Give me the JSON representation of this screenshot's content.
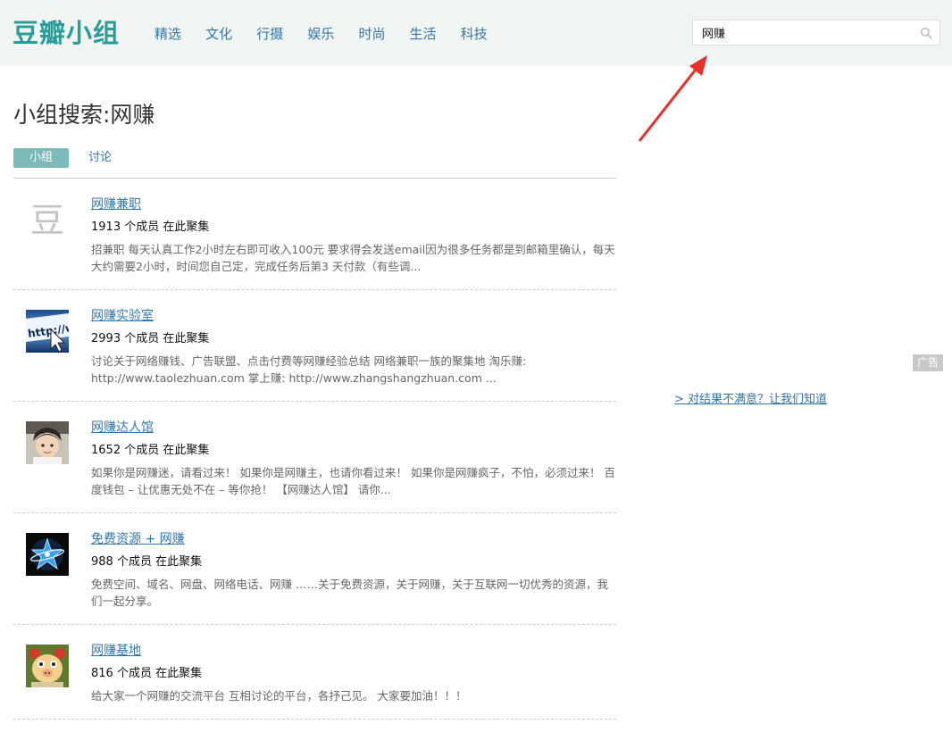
{
  "header": {
    "logo": "豆瓣小组",
    "nav": [
      "精选",
      "文化",
      "行摄",
      "娱乐",
      "时尚",
      "生活",
      "科技"
    ],
    "search_value": "网赚",
    "search_icon": "search-icon"
  },
  "page": {
    "title": "小组搜索:网赚",
    "tabs": {
      "active": "小组",
      "other": "讨论"
    }
  },
  "results": [
    {
      "name": "网赚兼职",
      "members": "1913 个成员 在此聚集",
      "desc": "招兼职 每天认真工作2小时左右即可收入100元 要求得会发送email因为很多任务都是到邮箱里确认，每天大约需要2小时，时间您自己定，完成任务后第3 天付款（有些调...",
      "avatar_text": "豆"
    },
    {
      "name": "网赚实验室",
      "members": "2993 个成员 在此聚集",
      "desc": "讨论关于网络赚钱、广告联盟、点击付费等网赚经验总结 网络兼职一族的聚集地 淘乐赚: http://www.taolezhuan.com 掌上赚: http://www.zhangshangzhuan.com ...",
      "avatar_text": "http://ww"
    },
    {
      "name": "网赚达人馆",
      "members": "1652 个成员 在此聚集",
      "desc": "如果你是网赚迷，请看过来！ 如果你是网赚主，也请你看过来！ 如果你是网赚疯子，不怕，必须过来！ 百度钱包 – 让优惠无处不在 – 等你抢！ 【网赚达人馆】 请你..."
    },
    {
      "name": "免费资源 + 网赚",
      "members": "988 个成员 在此聚集",
      "desc": "免费空间、域名、网盘、网络电话、网赚 ……关于免费资源，关于网赚，关于互联网一切优秀的资源，我们一起分享。"
    },
    {
      "name": "网赚基地",
      "members": "816 个成员 在此聚集",
      "desc": "给大家一个网赚的交流平台 互相讨论的平台，各抒己见。 大家要加油！！！"
    }
  ],
  "sidebar": {
    "ad_label": "广告",
    "feedback": "> 对结果不满意？让我们知道"
  },
  "colors": {
    "brand": "#2a9d98",
    "link": "#3377aa",
    "tab_active_bg": "#7cbbba",
    "header_bg": "#f0f5f3",
    "annotation_arrow": "#e8302a"
  }
}
